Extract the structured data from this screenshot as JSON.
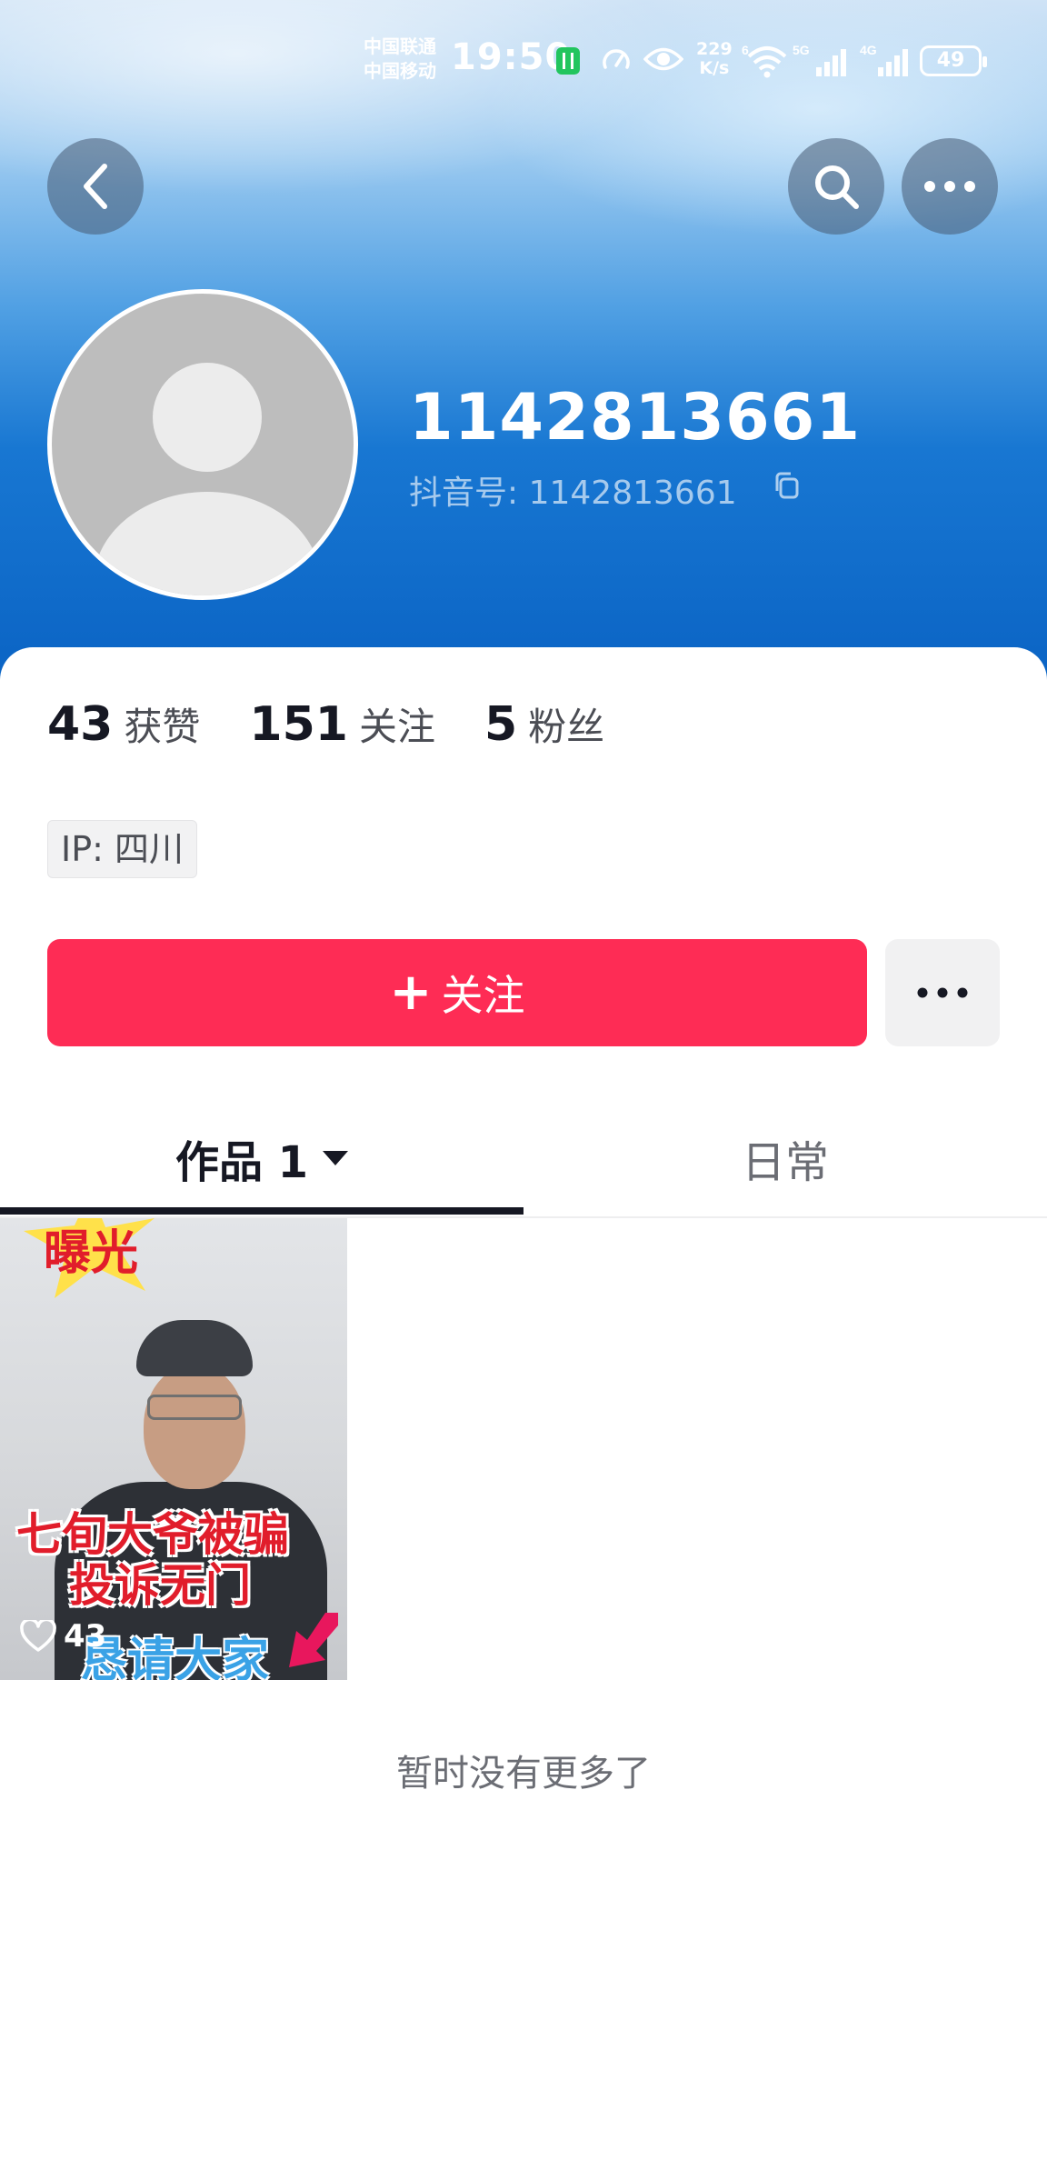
{
  "status_bar": {
    "carrier1": "中国联通",
    "carrier2": "中国移动",
    "time": "19:50",
    "net_speed_value": "229",
    "net_speed_unit": "K/s",
    "wifi_label": "6",
    "sig1_label": "5G",
    "sig2_label": "4G",
    "battery": "49"
  },
  "profile": {
    "username": "1142813661",
    "douyin_id_label": "抖音号:",
    "douyin_id": "1142813661"
  },
  "stats": [
    {
      "value": "43",
      "label": "获赞"
    },
    {
      "value": "151",
      "label": "关注"
    },
    {
      "value": "5",
      "label": "粉丝"
    }
  ],
  "ip": "IP:  四川",
  "actions": {
    "follow_label": "关注"
  },
  "tabs": {
    "works_label": "作品 1",
    "daily_label": "日常"
  },
  "video": {
    "top_text": "曝光",
    "line1": "七旬大爷被骗",
    "line2": "投诉无门",
    "line3": "恳请大家",
    "likes": "43"
  },
  "footer": {
    "no_more": "暂时没有更多了"
  },
  "colors": {
    "accent": "#fe2c55",
    "text_primary": "#161823",
    "header_blue": "#1877d2"
  },
  "icons": [
    "back-icon",
    "search-icon",
    "more-icon",
    "copy-icon",
    "heart-icon",
    "dots-icon"
  ]
}
